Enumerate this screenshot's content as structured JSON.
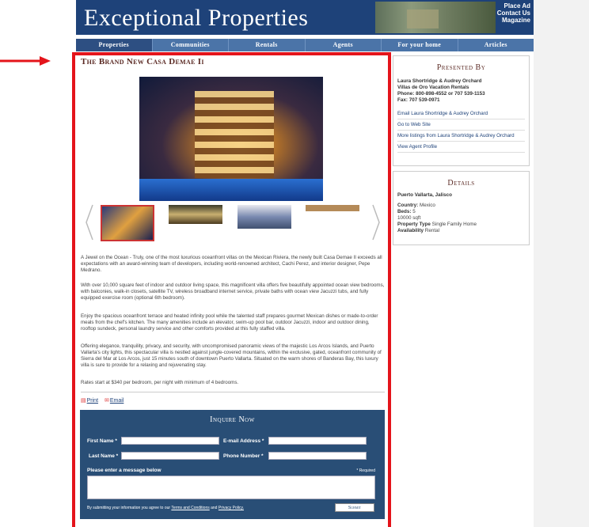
{
  "header": {
    "logo_main": "Exceptional Properties",
    "links": [
      "Place Ad",
      "Contact Us",
      "Magazine"
    ]
  },
  "nav": [
    "Properties",
    "Communities",
    "Rentals",
    "Agents",
    "For your home",
    "Articles"
  ],
  "listing": {
    "title": "The Brand New Casa Demae Ii",
    "paragraphs": [
      "A Jewel on the Ocean - Truly, one of the most luxurious oceanfront villas on the Mexican Riviera, the newly built Casa Demae II exceeds all expectations with an award-winning team of developers, including world-renowned architect, Cachi Perez, and interior designer, Pepe Medrano.",
      "With over 10,000 square feet of indoor and outdoor living space, this magnificent villa offers five beautifully appointed ocean view bedrooms, with balconies, walk-in closets, satellite TV, wireless broadband internet service, private baths with ocean view Jacuzzi tubs, and fully equipped exercise room (optional 6th bedroom).",
      "Enjoy the spacious oceanfront terrace and heated infinity pool while the talented staff prepares gourmet Mexican dishes or made-to-order meals from the chef's kitchen. The many amenities include an elevator, swim-up pool bar, outdoor Jacuzzi, indoor and outdoor dining, rooftop sundeck, personal laundry service and other comforts provided at this fully staffed villa.",
      "Offering elegance, tranquility, privacy, and security, with uncompromised panoramic views of the majestic Los Arcos Islands, and Puerto Vallarta's city lights, this spectacular villa is nestled against jungle-covered mountains, within the exclusive, gated, oceanfront community of Sierra del Mar at Los Arcos, just 15 minutes south of downtown Puerto Vallarta. Situated on the warm shores of Banderas Bay, this luxury villa is sure to provide for a relaxing and rejuvenating stay.",
      "Rates start at $340 per bedroom, per night with minimum of 4 bedrooms."
    ],
    "print_label": "Print",
    "email_label": "Email"
  },
  "inquire": {
    "title": "Inquire Now",
    "first_name": "First Name *",
    "email": "E-mail Address *",
    "last_name": "Last Name *",
    "phone": "Phone Number *",
    "message": "Please enter a message below",
    "required": "* Required",
    "disclaimer_pre": "By submitting your information you agree to our",
    "terms": "Terms and Conditions",
    "and": "and",
    "privacy": "Privacy Policy.",
    "submit": "Submit"
  },
  "presented": {
    "title": "Presented By",
    "lines": [
      "Laura Shortridge & Audrey Orchard",
      "Villas de Oro Vacation Rentals",
      "Phone: 800-898-4552 or 707 539-1153",
      "Fax: 707 539-0971"
    ],
    "links": [
      "Email Laura Shortridge & Audrey Orchard",
      "Go to Web Site",
      "More listings from Laura Shortridge & Audrey Orchard",
      "View Agent Profile"
    ]
  },
  "details": {
    "title": "Details",
    "location": "Puerto Vallarta, Jalisco",
    "rows": [
      {
        "k": "Country:",
        "v": "Mexico"
      },
      {
        "k": "Beds:",
        "v": "5"
      },
      {
        "k": "",
        "v": "10000 sqft"
      },
      {
        "k": "Property Type",
        "v": "Single Family Home"
      },
      {
        "k": "Availability",
        "v": "Rental"
      }
    ]
  }
}
